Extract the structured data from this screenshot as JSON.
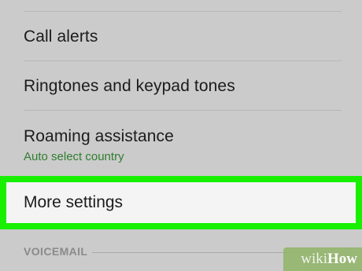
{
  "settings_list": {
    "items": [
      {
        "label": "Call alerts"
      },
      {
        "label": "Ringtones and keypad tones"
      },
      {
        "label": "Roaming assistance",
        "sublabel": "Auto select country"
      },
      {
        "label": "More settings",
        "highlighted": true
      }
    ]
  },
  "section": {
    "title": "VOICEMAIL"
  },
  "watermark": {
    "wiki": "wiki",
    "how": "How"
  },
  "colors": {
    "background": "#cbcbcb",
    "highlight_border": "#18f000",
    "sublabel": "#2f7d2f"
  }
}
